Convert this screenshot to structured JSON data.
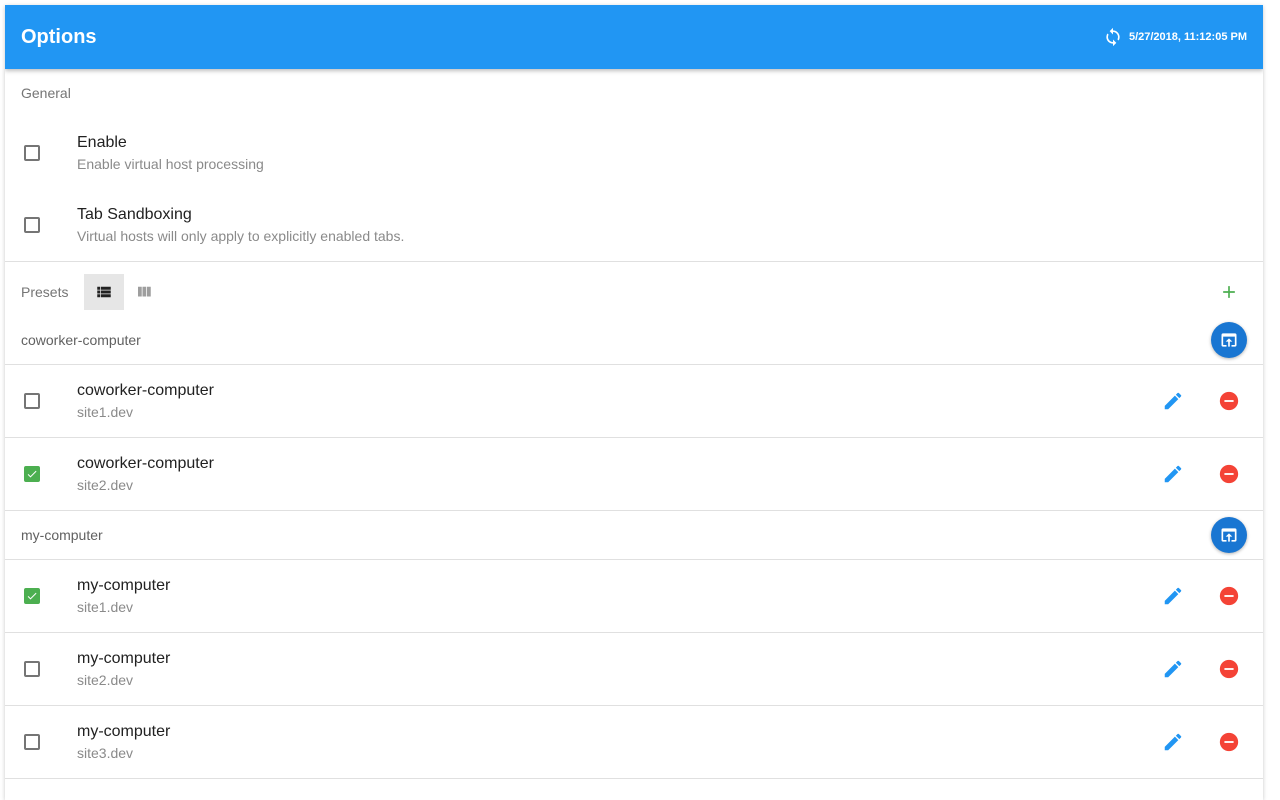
{
  "appbar": {
    "title": "Options",
    "timestamp": "5/27/2018, 11:12:05 PM"
  },
  "general": {
    "header": "General",
    "settings": [
      {
        "title": "Enable",
        "subtitle": "Enable virtual host processing",
        "checked": false
      },
      {
        "title": "Tab Sandboxing",
        "subtitle": "Virtual hosts will only apply to explicitly enabled tabs.",
        "checked": false
      }
    ]
  },
  "presets": {
    "label": "Presets",
    "view_mode": "list",
    "groups": [
      {
        "name": "coworker-computer",
        "items": [
          {
            "name": "coworker-computer",
            "host": "site1.dev",
            "checked": false
          },
          {
            "name": "coworker-computer",
            "host": "site2.dev",
            "checked": true
          }
        ]
      },
      {
        "name": "my-computer",
        "items": [
          {
            "name": "my-computer",
            "host": "site1.dev",
            "checked": true
          },
          {
            "name": "my-computer",
            "host": "site2.dev",
            "checked": false
          },
          {
            "name": "my-computer",
            "host": "site3.dev",
            "checked": false
          }
        ]
      }
    ]
  },
  "colors": {
    "appbar": "#2196f3",
    "checked": "#4caf50",
    "edit": "#2196f3",
    "remove": "#f44336",
    "add": "#4caf50",
    "fab": "#1976d2"
  },
  "icons": {
    "sync": "sync-icon",
    "list_view": "view-list-icon",
    "column_view": "view-column-icon",
    "add": "add-icon",
    "group_action": "open-in-browser-icon",
    "edit": "pencil-icon",
    "remove": "remove-circle-icon"
  }
}
